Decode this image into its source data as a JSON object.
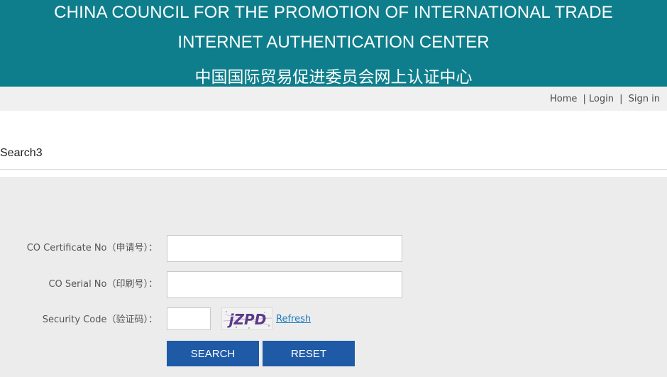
{
  "header": {
    "title_line1": "CHINA COUNCIL FOR THE PROMOTION OF INTERNATIONAL TRADE",
    "title_line2": "INTERNET AUTHENTICATION CENTER",
    "title_line3": "中国国际贸易促进委员会网上认证中心",
    "bg_color": "#0e7e8c"
  },
  "nav": {
    "home": "Home",
    "login": "Login",
    "signin": "Sign in",
    "sep1": "|",
    "sep2": "|"
  },
  "page": {
    "title": "Search3"
  },
  "form": {
    "co_certificate_label": "CO Certificate No（申请号）：",
    "co_serial_label": "CO Serial No（印刷号）：",
    "security_code_label": "Security Code（验证码）：",
    "co_certificate_value": "",
    "co_serial_value": "",
    "security_code_value": "",
    "captcha_text": "jZPD",
    "refresh_label": "Refresh",
    "search_button": "SEARCH",
    "reset_button": "RESET",
    "button_color": "#1f5aa6"
  }
}
